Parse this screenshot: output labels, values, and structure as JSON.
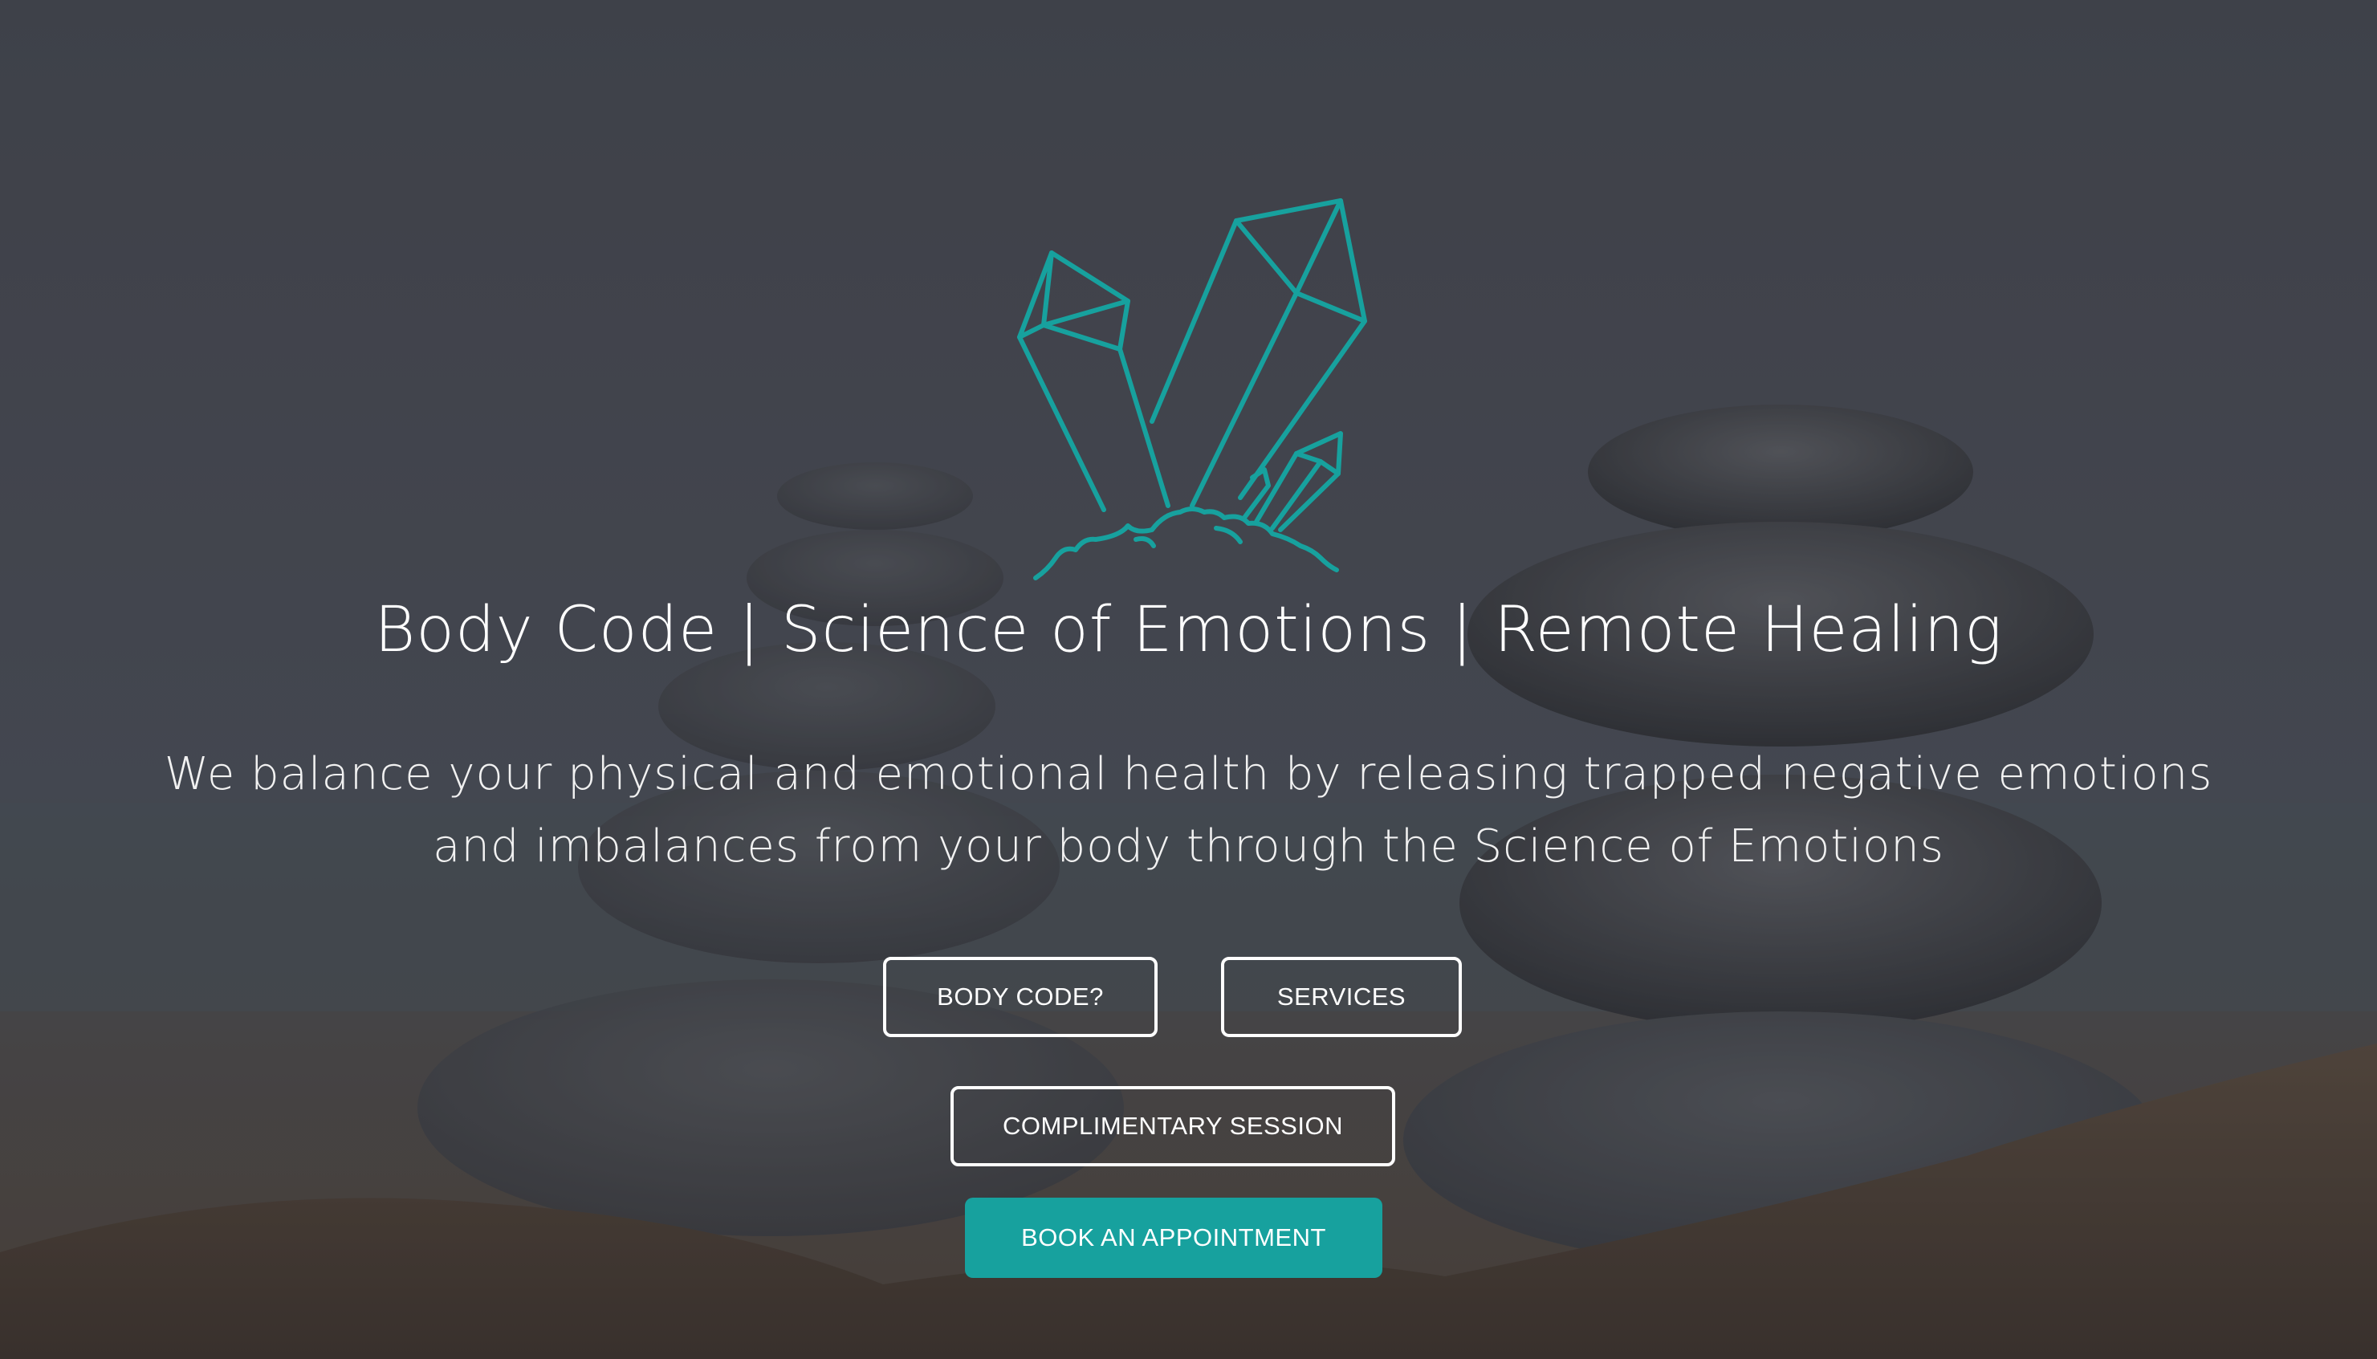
{
  "hero": {
    "logo_icon": "crystals-icon",
    "title": "Body Code | Science of Emotions | Remote Healing",
    "subtitle_line1": "We balance your physical and emotional health by releasing trapped negative emotions",
    "subtitle_line2": "and imbalances from your body through the Science of Emotions",
    "background_image": "stacked-stones-photo",
    "accent_color": "#17a19e"
  },
  "buttons": {
    "body_code": "BODY CODE?",
    "services": "SERVICES",
    "complimentary_session": "COMPLIMENTARY SESSION",
    "book_appointment": "BOOK AN APPOINTMENT"
  }
}
